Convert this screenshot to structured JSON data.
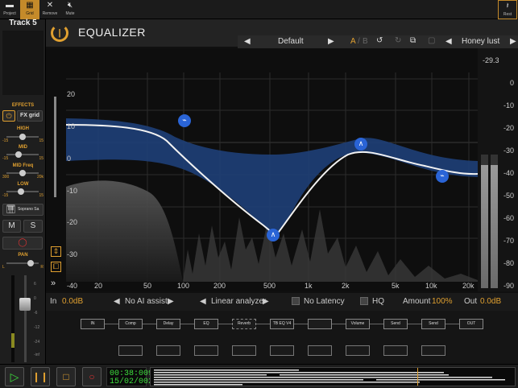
{
  "topbar": {
    "project_label": "Project",
    "grid_label": "Grid",
    "remove_label": "Remove",
    "mute_label": "Mute",
    "rest_label": "Rest"
  },
  "track": {
    "name": "Track 5"
  },
  "effects": {
    "title": "EFFECTS",
    "fx_grid_label": "FX grid",
    "high_label": "HIGH",
    "mid_label": "MID",
    "mid_freq_label": "MID Freq",
    "low_label": "LOW",
    "scale_min": "-15",
    "scale_max": "15",
    "freq_min": "300",
    "freq_max": "20k",
    "high_value": 0.5,
    "mid_value": 0.35,
    "mid_freq_value": 0.5,
    "low_value": 0.45,
    "instrument_label": "Soprano Sa",
    "m_label": "M",
    "s_label": "S",
    "pan_label": "PAN",
    "pan_l": "L",
    "pan_r": "R",
    "pan_value": 0.82,
    "fader_scale": [
      "6",
      "0",
      "-6",
      "-12",
      "-24",
      "-inf"
    ],
    "fader_value": 0.7
  },
  "plugin": {
    "title": "EQUALIZER",
    "preset": "Default",
    "ab_a": "A",
    "ab_sep": "/",
    "ab_b": "B",
    "preset_name": "Honey lust"
  },
  "graph": {
    "y_labels": [
      "20",
      "10",
      "0",
      "-10",
      "-20",
      "-30"
    ],
    "x_labels": [
      "-40",
      "20",
      "50",
      "100",
      "200",
      "500",
      "1k",
      "2k",
      "5k",
      "10k",
      "20k"
    ],
    "meter_labels": [
      "-29.3",
      "0",
      "-10",
      "-20",
      "-30",
      "-40",
      "-50",
      "-60",
      "-70",
      "-80",
      "-90"
    ]
  },
  "controls": {
    "in_label": "In",
    "in_value": "0.0dB",
    "ai_assist": "No AI assist",
    "analyzer": "Linear analyzer",
    "latency": "No Latency",
    "hq": "HQ",
    "amount_label": "Amount",
    "amount_value": "100%",
    "out_label": "Out",
    "out_value": "0.0dB"
  },
  "fx_chain": {
    "slots": [
      "IN",
      "Comp",
      "Delay",
      "EQ",
      "Reverb",
      "TB EQ V4",
      "",
      "Volume",
      "Send",
      "Send",
      "OUT"
    ]
  },
  "transport": {
    "time": "00:38:009",
    "bars": "15/02/002"
  },
  "colors": {
    "accent": "#e0a030",
    "eq_blue": "#2a64d6",
    "band_fill": "#1e3f78",
    "time_green": "#3ddc3d"
  }
}
